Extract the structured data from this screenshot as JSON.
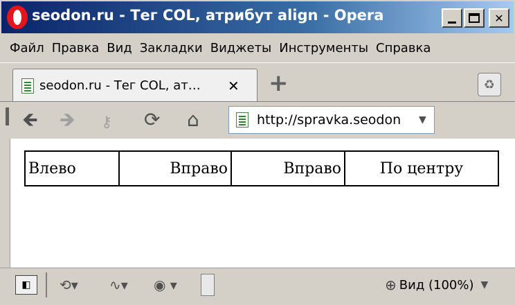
{
  "window": {
    "title": "seodon.ru - Тег COL, атрибут align - Opera",
    "minimize_label": "",
    "close_label": "✕"
  },
  "menu": {
    "items": [
      "Файл",
      "Правка",
      "Вид",
      "Закладки",
      "Виджеты",
      "Инструменты",
      "Справка"
    ]
  },
  "tabs": {
    "active": {
      "label": "seodon.ru - Тег COL, ат…",
      "close": "✕"
    },
    "new_tab": "+"
  },
  "navigation": {
    "back": "🡸",
    "forward": "🡺",
    "key": "⚷",
    "reload": "⟳",
    "home": "⌂",
    "address": "http://spravka.seodon",
    "address_dropdown": "▼"
  },
  "page": {
    "table": {
      "cells": [
        "Влево",
        "Вправо",
        "Вправо",
        "По центру"
      ]
    }
  },
  "statusbar": {
    "zoom_label": "Вид (100%)",
    "zoom_dropdown": "▼"
  },
  "icons": {
    "opera": "opera-logo",
    "trash": "trash-icon",
    "panel": "panel-toggle-icon",
    "sync": "sync-icon",
    "turbo": "turbo-icon",
    "speed": "speed-dial-icon",
    "zoom": "zoom-icon"
  }
}
